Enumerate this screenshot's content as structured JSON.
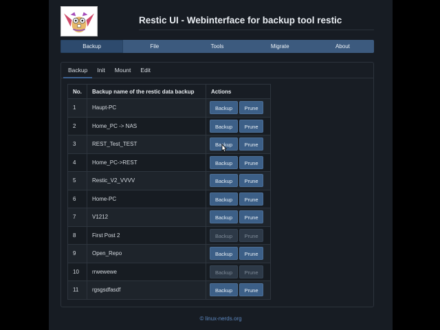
{
  "app": {
    "title": "Restic UI - Webinterface for backup tool restic",
    "logo_icon": "gopher-mascot-logo"
  },
  "navbar": {
    "items": [
      {
        "label": "Backup",
        "active": true
      },
      {
        "label": "File",
        "active": false
      },
      {
        "label": "Tools",
        "active": false
      },
      {
        "label": "Migrate",
        "active": false
      },
      {
        "label": "About",
        "active": false
      }
    ]
  },
  "tabs": [
    {
      "label": "Backup",
      "active": true
    },
    {
      "label": "Init",
      "active": false
    },
    {
      "label": "Mount",
      "active": false
    },
    {
      "label": "Edit",
      "active": false
    }
  ],
  "table": {
    "headers": [
      "No.",
      "Backup name of the restic data backup",
      "Actions"
    ],
    "backup_label": "Backup",
    "prune_label": "Prune",
    "rows": [
      {
        "no": "1",
        "name": "Haupt-PC",
        "enabled": true
      },
      {
        "no": "2",
        "name": "Home_PC -> NAS",
        "enabled": true
      },
      {
        "no": "3",
        "name": "REST_Test_TEST",
        "enabled": true
      },
      {
        "no": "4",
        "name": "Home_PC->REST",
        "enabled": true
      },
      {
        "no": "5",
        "name": "Restic_V2_VVVV",
        "enabled": true
      },
      {
        "no": "6",
        "name": "Home-PC",
        "enabled": true
      },
      {
        "no": "7",
        "name": "V1212",
        "enabled": true
      },
      {
        "no": "8",
        "name": "First Post 2",
        "enabled": false
      },
      {
        "no": "9",
        "name": "Open_Repo",
        "enabled": true
      },
      {
        "no": "10",
        "name": "rrwewewe",
        "enabled": false
      },
      {
        "no": "11",
        "name": "rgsgsdfasdf",
        "enabled": true
      }
    ]
  },
  "footer": {
    "text": "© linux-nerds.org"
  },
  "colors": {
    "accent": "#3c5a7e",
    "button": "#3c5f87",
    "button_disabled": "#2d3947",
    "link": "#5d88c0"
  }
}
